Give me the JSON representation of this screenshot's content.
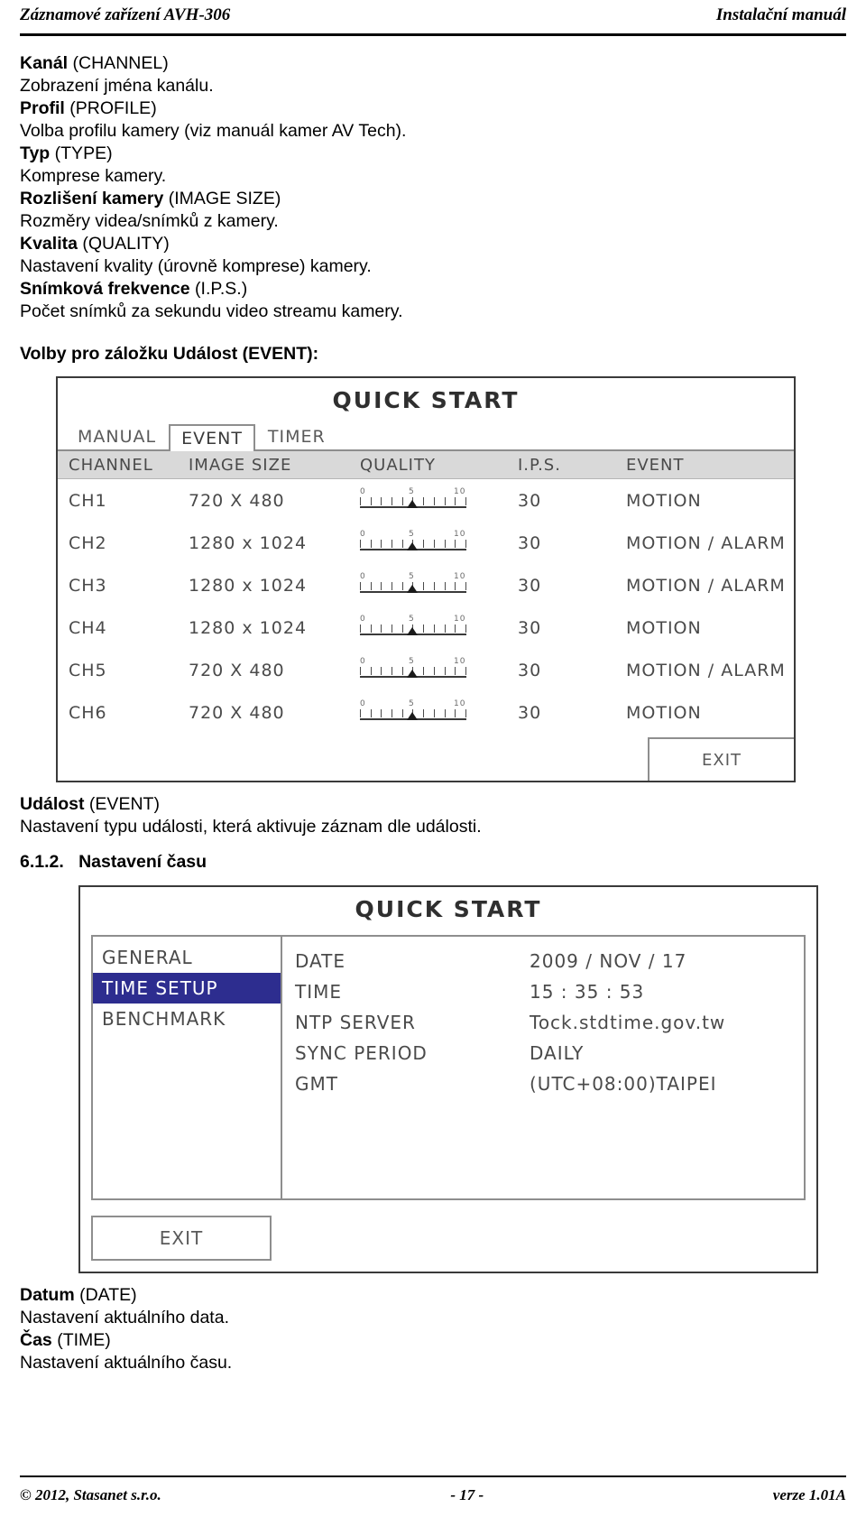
{
  "header": {
    "left": "Záznamové zařízení AVH-306",
    "right": "Instalační manuál"
  },
  "body": {
    "lines": [
      {
        "bold": "Kanál",
        "rest": " (CHANNEL)"
      },
      {
        "bold": "",
        "rest": "Zobrazení jména kanálu."
      },
      {
        "bold": "Profil",
        "rest": " (PROFILE)"
      },
      {
        "bold": "",
        "rest": "Volba profilu kamery (viz manuál kamer AV Tech)."
      },
      {
        "bold": "Typ",
        "rest": " (TYPE)"
      },
      {
        "bold": "",
        "rest": "Komprese kamery."
      },
      {
        "bold": "Rozlišení kamery",
        "rest": " (IMAGE SIZE)"
      },
      {
        "bold": "",
        "rest": "Rozměry videa/snímků z kamery."
      },
      {
        "bold": "Kvalita",
        "rest": " (QUALITY)"
      },
      {
        "bold": "",
        "rest": "Nastavení kvality (úrovně komprese) kamery."
      },
      {
        "bold": "Snímková frekvence",
        "rest": " (I.P.S.)"
      },
      {
        "bold": "",
        "rest": "Počet snímků za sekundu video streamu kamery."
      }
    ],
    "event_intro": "Volby pro záložku Událost (EVENT):",
    "event_caption_bold": "Událost",
    "event_caption_rest": " (EVENT)",
    "event_caption_line2": "Nastavení typu události, která aktivuje záznam dle události.",
    "section_number": "6.1.2.",
    "section_title": "Nastavení času",
    "date_caption_bold": "Datum",
    "date_caption_rest": " (DATE)",
    "date_caption_line2": "Nastavení aktuálního data.",
    "time_caption_bold": "Čas",
    "time_caption_rest": " (TIME)",
    "time_caption_line2": "Nastavení aktuálního času."
  },
  "event_panel": {
    "title": "QUICK START",
    "tabs": [
      {
        "label": "MANUAL",
        "active": false
      },
      {
        "label": "EVENT",
        "active": true
      },
      {
        "label": "TIMER",
        "active": false
      }
    ],
    "columns": [
      "CHANNEL",
      "IMAGE SIZE",
      "QUALITY",
      "I.P.S.",
      "EVENT"
    ],
    "quality_scale": [
      "0",
      "5",
      "10"
    ],
    "rows": [
      {
        "channel": "CH1",
        "size": "720 X 480",
        "quality": 5,
        "ips": "30",
        "event": "MOTION"
      },
      {
        "channel": "CH2",
        "size": "1280 x 1024",
        "quality": 5,
        "ips": "30",
        "event": "MOTION / ALARM"
      },
      {
        "channel": "CH3",
        "size": "1280 x 1024",
        "quality": 5,
        "ips": "30",
        "event": "MOTION / ALARM"
      },
      {
        "channel": "CH4",
        "size": "1280 x 1024",
        "quality": 5,
        "ips": "30",
        "event": "MOTION"
      },
      {
        "channel": "CH5",
        "size": "720 X 480",
        "quality": 5,
        "ips": "30",
        "event": "MOTION / ALARM"
      },
      {
        "channel": "CH6",
        "size": "720 X 480",
        "quality": 5,
        "ips": "30",
        "event": "MOTION"
      }
    ],
    "exit_label": "EXIT"
  },
  "time_panel": {
    "title": "QUICK START",
    "menu": [
      {
        "label": "GENERAL",
        "selected": false
      },
      {
        "label": "TIME SETUP",
        "selected": true
      },
      {
        "label": "BENCHMARK",
        "selected": false
      }
    ],
    "fields": [
      {
        "label": "DATE",
        "value": "2009 / NOV / 17"
      },
      {
        "label": "TIME",
        "value": "15 : 35 : 53"
      },
      {
        "label": "NTP SERVER",
        "value": "Tock.stdtime.gov.tw"
      },
      {
        "label": "SYNC PERIOD",
        "value": "DAILY"
      },
      {
        "label": "GMT",
        "value": "(UTC+08:00)TAIPEI"
      }
    ],
    "exit_label": "EXIT"
  },
  "footer": {
    "left": "© 2012, Stasanet s.r.o.",
    "center": "- 17 -",
    "right": "verze 1.01A"
  }
}
